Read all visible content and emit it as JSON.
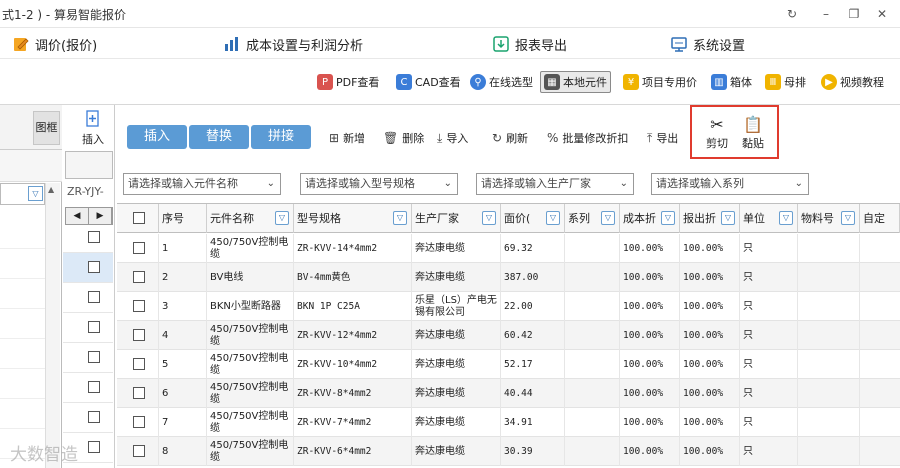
{
  "window": {
    "title": "式1-2 ) - 算易智能报价",
    "controls": [
      "↻",
      "–",
      "❐",
      "✕"
    ]
  },
  "menu": {
    "items": [
      {
        "label": "调价(报价)",
        "icon": "edit-icon",
        "color": "#e58a1f"
      },
      {
        "label": "成本设置与利润分析",
        "icon": "bar-chart-icon",
        "color": "#2f6eb5"
      },
      {
        "label": "报表导出",
        "icon": "export-report-icon",
        "color": "#1aa36f"
      },
      {
        "label": "系统设置",
        "icon": "settings-icon",
        "color": "#2f6eb5"
      }
    ]
  },
  "toolbar": {
    "items": [
      {
        "label": "PDF查看",
        "icon": "pdf-icon",
        "color": "#d9534f"
      },
      {
        "label": "CAD查看",
        "icon": "cad-icon",
        "color": "#3b7dd8"
      },
      {
        "label": "在线选型",
        "icon": "search-online-icon",
        "color": "#3b7dd8"
      },
      {
        "label": "本地元件",
        "icon": "local-component-icon",
        "color": "#555555"
      },
      {
        "label": "项目专用价",
        "icon": "project-price-icon",
        "color": "#f0b400"
      },
      {
        "label": "箱体",
        "icon": "cabinet-icon",
        "color": "#3b7dd8"
      },
      {
        "label": "母排",
        "icon": "busbar-icon",
        "color": "#f0b400"
      },
      {
        "label": "视频教程",
        "icon": "video-icon",
        "color": "#f0b400"
      }
    ]
  },
  "left_panel": {
    "tab_label": "图框"
  },
  "mid_strip": {
    "insert_label": "插入",
    "code_text": "ZR-YJY-",
    "nav": [
      "◀",
      "▶"
    ]
  },
  "actions": {
    "insert": "插入",
    "replace": "替换",
    "splice": "拼接",
    "add": "新增",
    "delete": "删除",
    "import": "导入",
    "refresh": "刷新",
    "batch_discount": "批量修改折扣",
    "export": "导出",
    "cut": "剪切",
    "paste": "黏贴"
  },
  "filters": {
    "name_placeholder": "请选择或输入元件名称",
    "model_placeholder": "请选择或输入型号规格",
    "maker_placeholder": "请选择或输入生产厂家",
    "series_placeholder": "请选择或输入系列"
  },
  "table": {
    "headers": [
      "序号",
      "元件名称",
      "型号规格",
      "生产厂家",
      "面价(",
      "系列",
      "成本折",
      "报出折",
      "单位",
      "物料号",
      "自定"
    ],
    "rows": [
      {
        "no": "1",
        "name": "450/750V控制电缆",
        "model": "ZR-KVV-14*4mm2",
        "maker": "奔达康电缆",
        "price": "69.32",
        "series": "",
        "cost": "100.00%",
        "quote": "100.00%",
        "unit": "只"
      },
      {
        "no": "2",
        "name": "BV电线",
        "model": "BV-4mm黄色",
        "maker": "奔达康电缆",
        "price": "387.00",
        "series": "",
        "cost": "100.00%",
        "quote": "100.00%",
        "unit": "只"
      },
      {
        "no": "3",
        "name": "BKN小型断路器",
        "model": "BKN 1P C25A",
        "maker": "乐星（LS）产电无锡有限公司",
        "price": "22.00",
        "series": "",
        "cost": "100.00%",
        "quote": "100.00%",
        "unit": "只"
      },
      {
        "no": "4",
        "name": "450/750V控制电缆",
        "model": "ZR-KVV-12*4mm2",
        "maker": "奔达康电缆",
        "price": "60.42",
        "series": "",
        "cost": "100.00%",
        "quote": "100.00%",
        "unit": "只"
      },
      {
        "no": "5",
        "name": "450/750V控制电缆",
        "model": "ZR-KVV-10*4mm2",
        "maker": "奔达康电缆",
        "price": "52.17",
        "series": "",
        "cost": "100.00%",
        "quote": "100.00%",
        "unit": "只"
      },
      {
        "no": "6",
        "name": "450/750V控制电缆",
        "model": "ZR-KVV-8*4mm2",
        "maker": "奔达康电缆",
        "price": "40.44",
        "series": "",
        "cost": "100.00%",
        "quote": "100.00%",
        "unit": "只"
      },
      {
        "no": "7",
        "name": "450/750V控制电缆",
        "model": "ZR-KVV-7*4mm2",
        "maker": "奔达康电缆",
        "price": "34.91",
        "series": "",
        "cost": "100.00%",
        "quote": "100.00%",
        "unit": "只"
      },
      {
        "no": "8",
        "name": "450/750V控制电缆",
        "model": "ZR-KVV-6*4mm2",
        "maker": "奔达康电缆",
        "price": "30.39",
        "series": "",
        "cost": "100.00%",
        "quote": "100.00%",
        "unit": "只"
      }
    ]
  },
  "watermark": "大数智造"
}
